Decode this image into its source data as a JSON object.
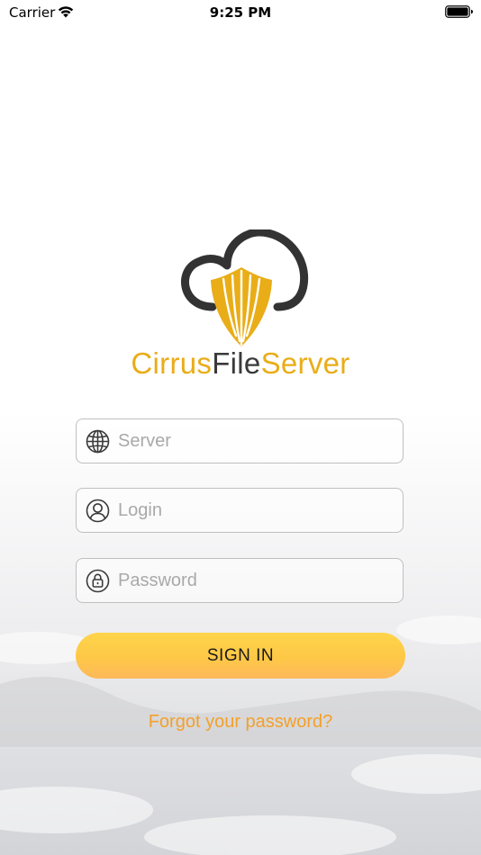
{
  "status_bar": {
    "carrier": "Carrier",
    "time": "9:25 PM",
    "wifi_icon": "wifi-icon",
    "battery_icon": "battery-icon"
  },
  "brand": {
    "logo_icon": "cloud-shield-logo",
    "name_part_1": "Cirrus",
    "name_part_2": "File",
    "name_part_3": "Server",
    "primary_color": "#e9ad18",
    "secondary_color": "#3a3a3a"
  },
  "form": {
    "server": {
      "placeholder": "Server",
      "value": "",
      "icon": "globe-icon"
    },
    "login": {
      "placeholder": "Login",
      "value": "",
      "icon": "user-icon"
    },
    "password": {
      "placeholder": "Password",
      "value": "",
      "icon": "lock-icon"
    },
    "sign_in_label": "SIGN IN",
    "forgot_label": "Forgot your password?",
    "accent_color": "#f3a02a"
  }
}
